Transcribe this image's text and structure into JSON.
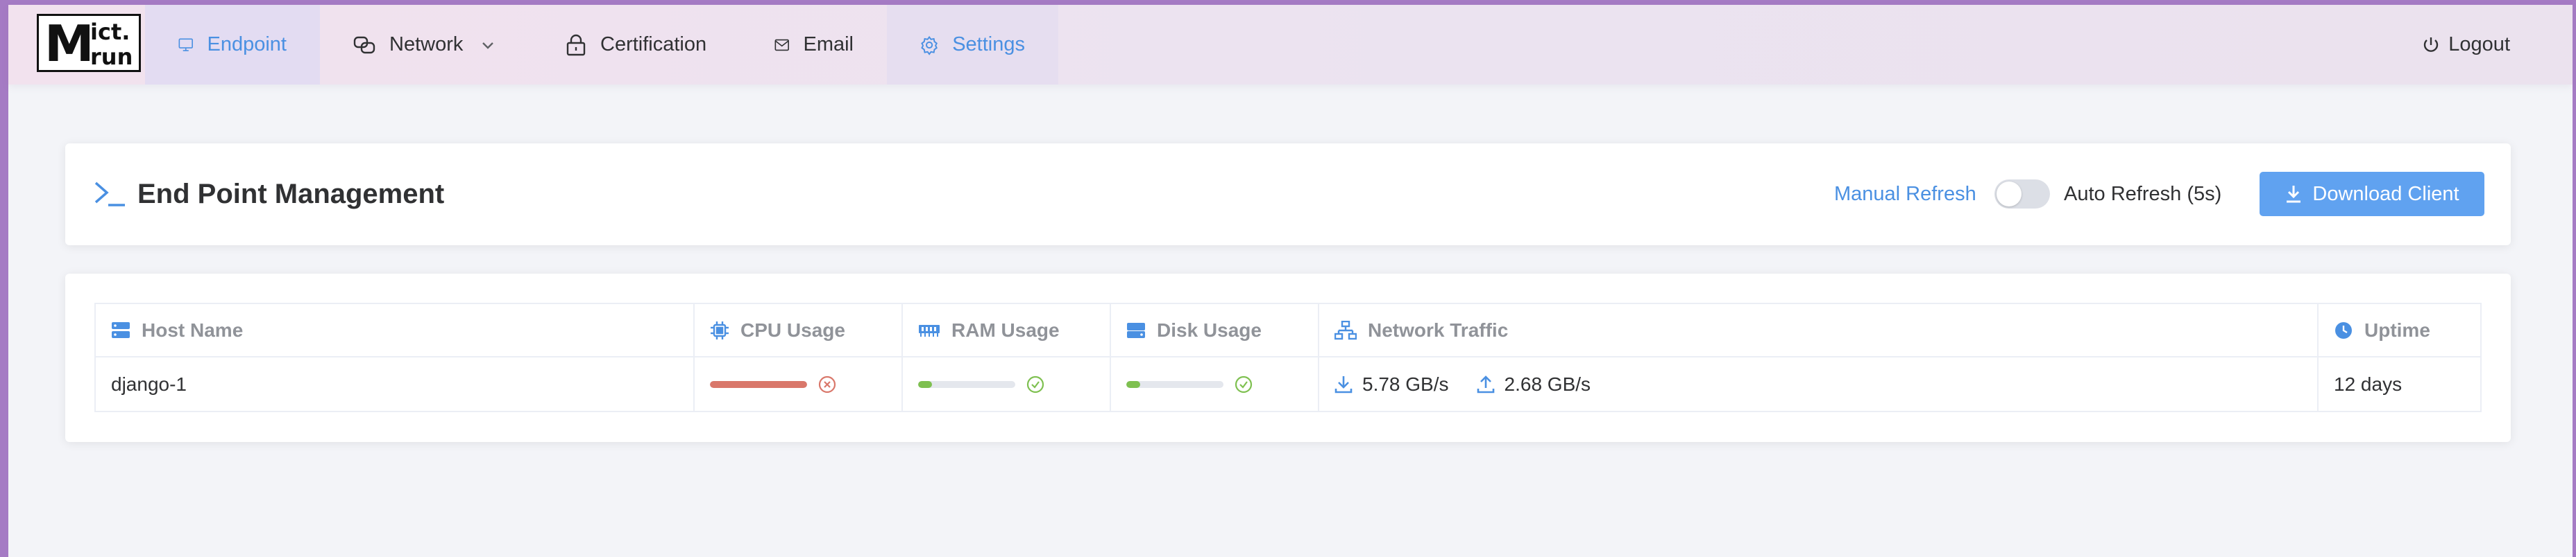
{
  "logo": {
    "letter": "M",
    "line1": "ict.",
    "line2": "run"
  },
  "nav": {
    "items": [
      {
        "label": "Endpoint",
        "icon": "monitor-icon"
      },
      {
        "label": "Network",
        "icon": "link-icon"
      },
      {
        "label": "Certification",
        "icon": "lock-icon"
      },
      {
        "label": "Email",
        "icon": "envelope-icon"
      },
      {
        "label": "Settings",
        "icon": "gear-icon"
      }
    ],
    "logout": "Logout"
  },
  "header": {
    "title": "End Point Management",
    "manual_refresh": "Manual Refresh",
    "auto_refresh": "Auto Refresh (5s)",
    "auto_refresh_on": false,
    "download_button": "Download Client"
  },
  "colors": {
    "accent": "#4a90e2",
    "danger": "#d9776a",
    "success": "#7ec050",
    "button": "#60a2f0"
  },
  "table": {
    "columns": [
      "Host Name",
      "CPU Usage",
      "RAM Usage",
      "Disk Usage",
      "Network Traffic",
      "Uptime"
    ],
    "rows": [
      {
        "host": "django-1",
        "cpu": 1.0,
        "cpu_status": "error",
        "ram": 0.14,
        "ram_status": "ok",
        "disk": 0.14,
        "disk_status": "ok",
        "download": "5.78 GB/s",
        "upload": "2.68 GB/s",
        "uptime": "12 days"
      }
    ]
  }
}
